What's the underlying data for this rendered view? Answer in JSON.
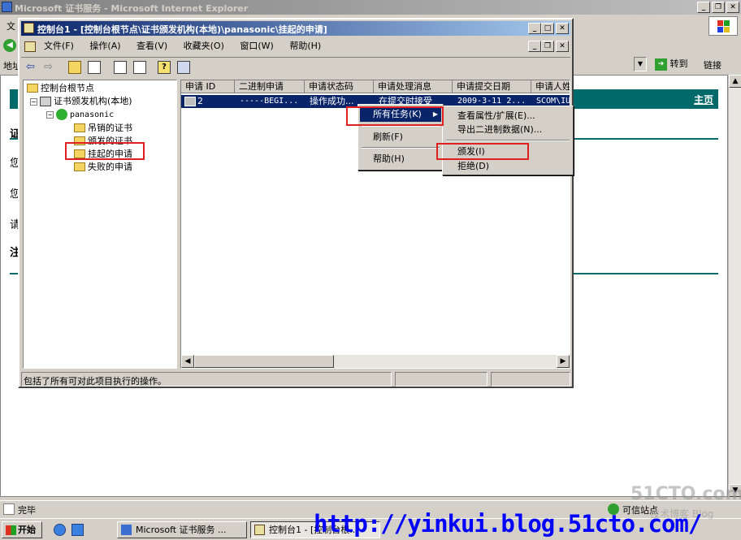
{
  "ie": {
    "title": "Microsoft 证书服务 - Microsoft Internet Explorer",
    "menu_partial": "文",
    "addr_partial": "地址",
    "goto": "转到",
    "links": "链接",
    "home_link": "主页",
    "status": "完毕",
    "zone": "可信站点",
    "page_chars": [
      "证",
      "您",
      "您",
      "请",
      "注"
    ]
  },
  "mmc": {
    "title": "控制台1 - [控制台根节点\\证书颁发机构(本地)\\panasonic\\挂起的申请]",
    "menu": [
      "文件(F)",
      "操作(A)",
      "查看(V)",
      "收藏夹(O)",
      "窗口(W)",
      "帮助(H)"
    ],
    "tree": {
      "root": "控制台根节点",
      "ca": "证书颁发机构(本地)",
      "server": "panasonic",
      "children": [
        "吊销的证书",
        "颁发的证书",
        "挂起的申请",
        "失败的申请"
      ]
    },
    "columns": [
      "申请 ID",
      "二进制申请",
      "申请状态码",
      "申请处理消息",
      "申请提交日期",
      "申请人姓"
    ],
    "row": [
      "2",
      "-----BEGI...",
      "操作成功...",
      "在提交时接受",
      "2009-3-11 2...",
      "SCOM\\IU"
    ],
    "status": "包括了所有可对此项目执行的操作。"
  },
  "context_menu": {
    "items": [
      "所有任务(K)",
      "刷新(F)",
      "帮助(H)"
    ]
  },
  "submenu": {
    "items": [
      "查看属性/扩展(E)...",
      "导出二进制数据(N)...",
      "颁发(I)",
      "拒绝(D)"
    ]
  },
  "taskbar": {
    "start": "开始",
    "tasks": [
      "Microsoft 证书服务 ...",
      "控制台1 - [控制台根..."
    ]
  },
  "watermark": {
    "url": "http://yinkui.blog.51cto.com/",
    "logo": "51CTO.com",
    "sub": "技术博客 Blog"
  },
  "colors": {
    "selection": "#0a246a",
    "highlight_box": "#e02020",
    "link": "#0000ff",
    "teal_bar": "#006a6a"
  }
}
